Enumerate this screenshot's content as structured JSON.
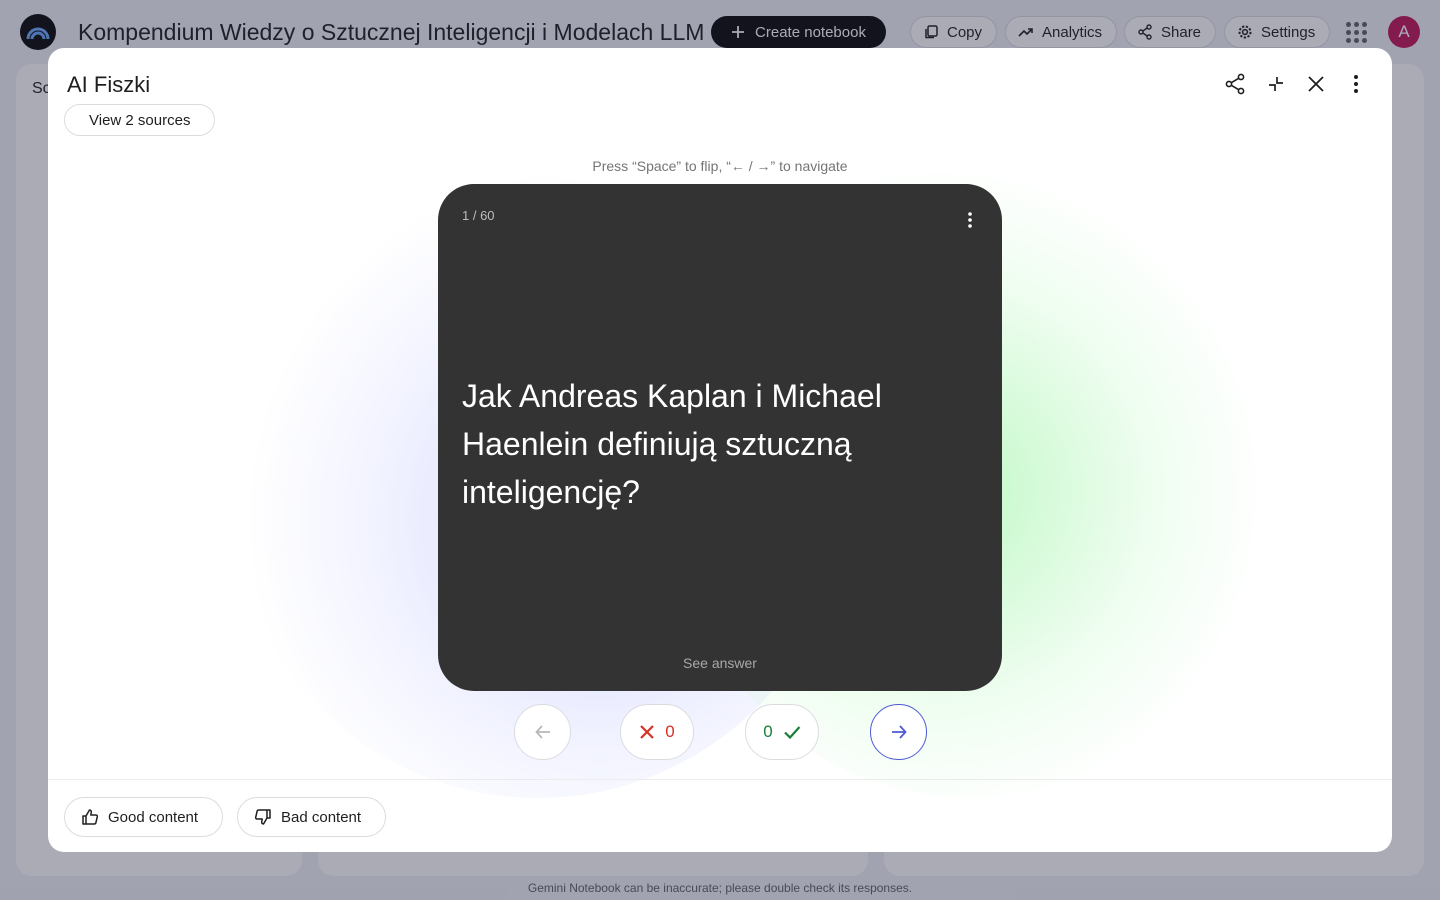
{
  "app": {
    "notebook_title": "Kompendium Wiedzy o Sztucznej Inteligencji i Modelach LLM",
    "create_label": "Create notebook",
    "copy_label": "Copy",
    "analytics_label": "Analytics",
    "share_label": "Share",
    "settings_label": "Settings",
    "avatar_letter": "A",
    "panel_tab_partial": "Sc",
    "footer_note": "Gemini Notebook can be inaccurate; please double check its responses."
  },
  "modal": {
    "title": "AI Fiszki",
    "sources_label": "View 2 sources",
    "hint": "Press “Space” to flip, “← / →” to navigate",
    "card": {
      "counter": "1 / 60",
      "question": "Jak Andreas Kaplan i Michael Haenlein definiują sztuczną inteligencję?",
      "see_answer": "See answer"
    },
    "controls": {
      "wrong_count": "0",
      "right_count": "0"
    },
    "feedback": {
      "good_label": "Good content",
      "bad_label": "Bad content"
    }
  },
  "colors": {
    "accent": "#4c5bd4",
    "wrong": "#d93025",
    "right": "#188038",
    "card_bg": "#333333"
  }
}
